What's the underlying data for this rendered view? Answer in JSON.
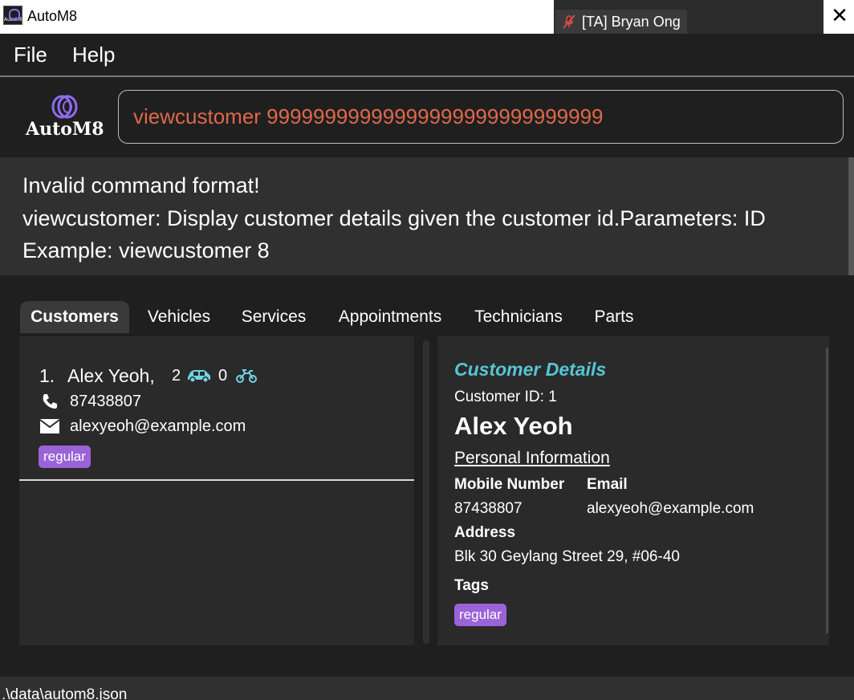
{
  "window": {
    "title": "AutoM8",
    "icon_label": "AutoM8",
    "presenter_name": "[TA] Bryan Ong",
    "close_symbol": "✕"
  },
  "menu": {
    "file": "File",
    "help": "Help"
  },
  "logo": {
    "text": "AutoM8"
  },
  "command": {
    "value": "viewcustomer 99999999999999999999999999999"
  },
  "result": {
    "lines": [
      "Invalid command format!",
      "viewcustomer: Display customer details given the customer id.Parameters: ID",
      "Example: viewcustomer 8"
    ]
  },
  "tabs": [
    {
      "label": "Customers",
      "active": true
    },
    {
      "label": "Vehicles"
    },
    {
      "label": "Services"
    },
    {
      "label": "Appointments"
    },
    {
      "label": "Technicians"
    },
    {
      "label": "Parts"
    }
  ],
  "customer_list": [
    {
      "index": "1.",
      "name": "Alex Yeoh,",
      "car_count": "2",
      "bike_count": "0",
      "phone": "87438807",
      "email": "alexyeoh@example.com",
      "tag": "regular"
    }
  ],
  "details": {
    "heading": "Customer Details",
    "customer_id": "Customer ID: 1",
    "name": "Alex Yeoh",
    "section": "Personal Information",
    "mobile_label": "Mobile Number",
    "mobile_value": "87438807",
    "email_label": "Email",
    "email_value": "alexyeoh@example.com",
    "address_label": "Address",
    "address_value": "Blk 30 Geylang Street 29, #06-40",
    "tags_label": "Tags",
    "tag": "regular"
  },
  "status": {
    "path": ".\\data\\autom8.json"
  },
  "colors": {
    "accent_tag": "#9b63d8",
    "command_text": "#e0684a",
    "detail_heading": "#55c6d4",
    "icon_cyan": "#6fd4e6"
  }
}
